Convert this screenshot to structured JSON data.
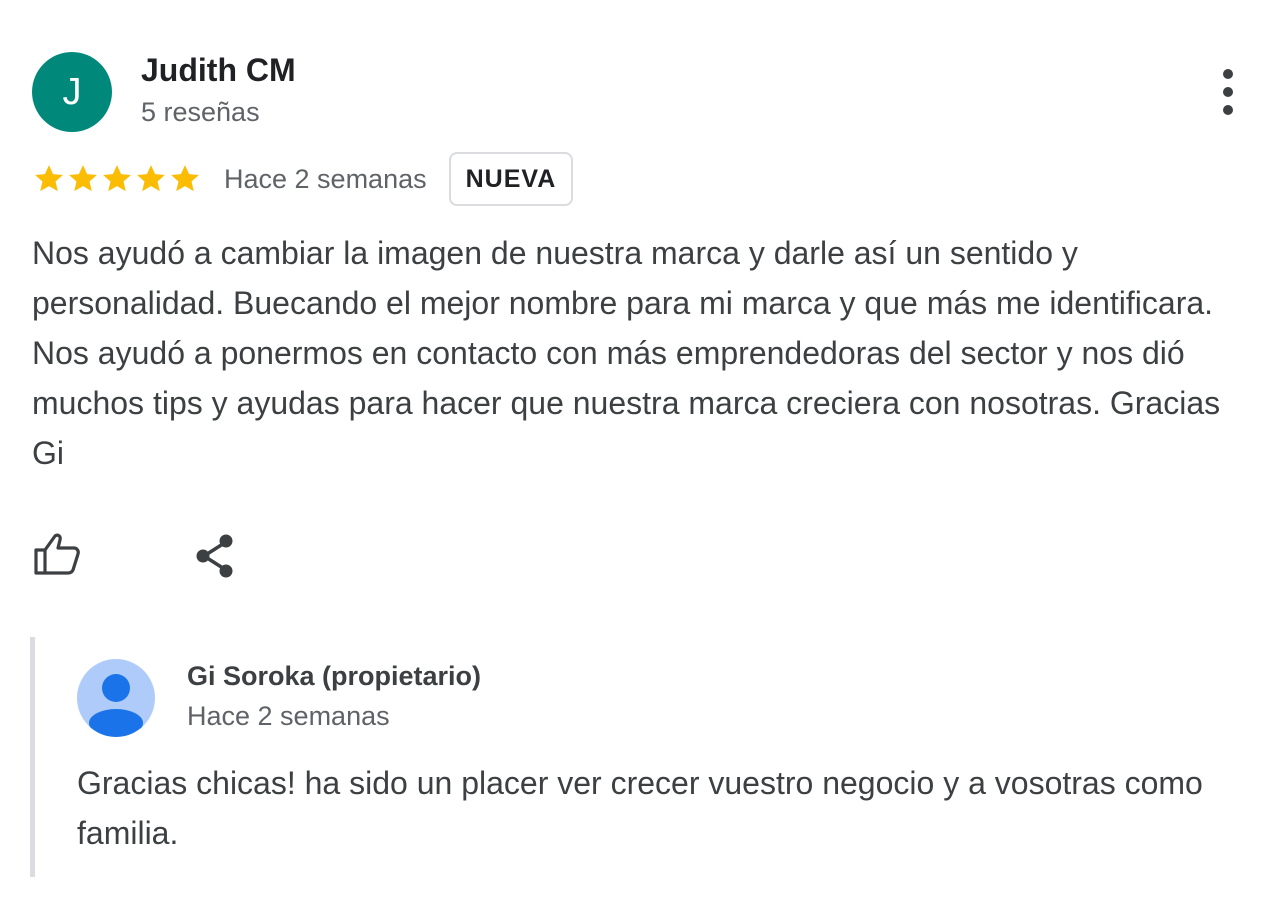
{
  "review": {
    "avatar_letter": "J",
    "avatar_color": "#00897b",
    "reviewer_name": "Judith CM",
    "reviewer_meta": "5 reseñas",
    "rating": 5,
    "rating_max": 5,
    "star_color": "#fbbc04",
    "date": "Hace 2 semanas",
    "badge": "NUEVA",
    "text": "Nos ayudó a cambiar la imagen de nuestra marca y darle así un sentido y personalidad. Buecando el mejor nombre para mi marca y que más me identificara. Nos ayudó a ponermos en contacto con más emprendedoras del sector y nos dió muchos tips y ayudas para hacer que nuestra marca creciera con nosotras. Gracias Gi",
    "icons": {
      "more": "more-vertical-icon",
      "like": "thumbs-up-icon",
      "share": "share-icon"
    }
  },
  "owner_reply": {
    "name": "Gi Soroka (propietario)",
    "date": "Hace 2 semanas",
    "text": "Gracias chicas! ha sido un placer ver crecer vuestro negocio y a vosotras como familia.",
    "avatar_icon": "default-profile-icon",
    "avatar_bg": "#aecbfa",
    "avatar_fg": "#1a73e8"
  }
}
